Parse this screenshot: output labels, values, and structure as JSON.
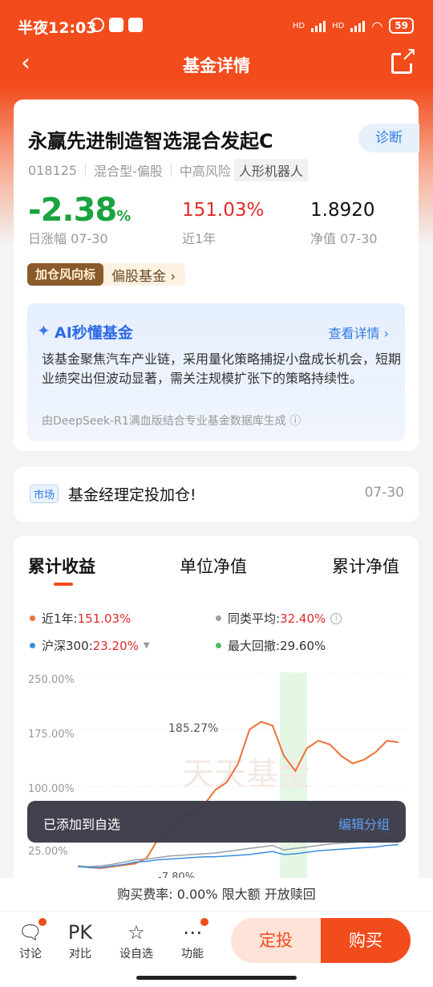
{
  "status_bar": {
    "time": "半夜12:03",
    "battery": "59",
    "hd1": "HD",
    "hd2": "HD"
  },
  "header": {
    "title": "基金详情"
  },
  "fund": {
    "name": "永赢先进制造智选混合发起C",
    "diagnose_label": "诊断",
    "code": "018125",
    "type": "混合型-偏股",
    "risk": "中高风险",
    "theme": "人形机器人",
    "daily_change": "-2.38",
    "daily_change_unit": "%",
    "daily_change_label": "日涨幅 07-30",
    "year_return": "151.03%",
    "year_return_label": "近1年",
    "nav": "1.8920",
    "nav_label": "净值 07-30",
    "trend_badge": "加仓风向标",
    "trend_text": "偏股基金 ›"
  },
  "ai": {
    "title": "AI秒懂基金",
    "more": "查看详情 ›",
    "text": "该基金聚焦汽车产业链，采用量化策略捕捉小盘成长机会，短期业绩突出但波动显著，需关注规模扩张下的策略持续性。",
    "note": "由DeepSeek-R1满血版结合专业基金数据库生成 ⓘ"
  },
  "news": {
    "tag": "市场",
    "text": "基金经理定投加仓!",
    "date": "07-30"
  },
  "chart_tabs": [
    "累计收益",
    "单位净值",
    "累计净值"
  ],
  "legend": {
    "fund_label": "近1年:",
    "fund_value": "151.03%",
    "avg_label": "同类平均:",
    "avg_value": "32.40%",
    "hs300_label": "沪深300:",
    "hs300_value": "23.20%",
    "drawdown_label": "最大回撤:",
    "drawdown_value": "29.60%"
  },
  "chart_data": {
    "type": "line",
    "y_tick_labels": [
      "250.00%",
      "175.00%",
      "100.00%",
      "25.00%"
    ],
    "ylim": [
      -25,
      250
    ],
    "annotations": [
      "185.27%",
      "-7.80%"
    ],
    "series": [
      {
        "name": "近1年",
        "color": "#f0703a",
        "values": [
          -5,
          -7,
          -8,
          -6,
          -4,
          -2,
          5,
          30,
          38,
          60,
          65,
          75,
          95,
          105,
          130,
          175,
          185,
          180,
          140,
          120,
          150,
          160,
          155,
          140,
          130,
          135,
          145,
          160,
          158
        ]
      },
      {
        "name": "同类平均",
        "color": "#9aa0a8",
        "values": [
          -5,
          -6,
          -5,
          -3,
          0,
          3,
          4,
          6,
          8,
          9,
          10,
          11,
          12,
          14,
          16,
          18,
          20,
          22,
          16,
          18,
          20,
          22,
          24,
          25,
          26,
          27,
          28,
          31,
          32
        ]
      },
      {
        "name": "沪深300",
        "color": "#3b8ee0",
        "values": [
          -6,
          -7,
          -7,
          -5,
          -3,
          0,
          1,
          3,
          4,
          5,
          6,
          7,
          7,
          8,
          9,
          10,
          12,
          14,
          10,
          11,
          13,
          15,
          16,
          17,
          18,
          19,
          20,
          22,
          23
        ]
      }
    ],
    "grid": true,
    "watermark": "天天基金"
  },
  "toast": {
    "message": "已添加到自选",
    "action": "编辑分组"
  },
  "fee": {
    "text": "购买费率: 0.00% 限大额 开放赎回"
  },
  "bottom_bar": {
    "items": [
      "讨论",
      "对比",
      "设自选",
      "功能"
    ],
    "pk": "PK",
    "invest_label": "定投",
    "buy_label": "购买"
  }
}
